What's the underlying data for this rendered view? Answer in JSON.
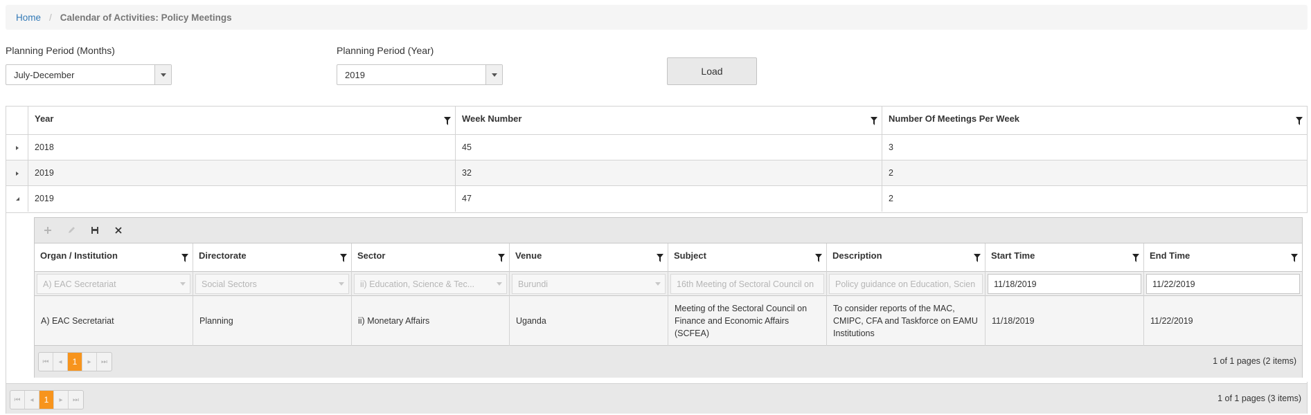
{
  "breadcrumb": {
    "home": "Home",
    "separator": "/",
    "current": "Calendar of Activities: Policy Meetings"
  },
  "filters": {
    "months_label": "Planning Period (Months)",
    "months_value": "July-December",
    "year_label": "Planning Period (Year)",
    "year_value": "2019",
    "load_label": "Load"
  },
  "grid": {
    "columns": [
      "Year",
      "Week Number",
      "Number Of Meetings Per Week"
    ],
    "rows": [
      {
        "year": "2018",
        "week": "45",
        "meetings": "3",
        "expanded": false
      },
      {
        "year": "2019",
        "week": "32",
        "meetings": "2",
        "expanded": false
      },
      {
        "year": "2019",
        "week": "47",
        "meetings": "2",
        "expanded": true
      }
    ],
    "pager": {
      "page": "1",
      "info": "1 of 1 pages (3 items)"
    }
  },
  "detail": {
    "columns": [
      "Organ / Institution",
      "Directorate",
      "Sector",
      "Venue",
      "Subject",
      "Description",
      "Start Time",
      "End Time"
    ],
    "edit_row": {
      "organ": "A) EAC Secretariat",
      "directorate": "Social Sectors",
      "sector": "ii) Education, Science & Tec...",
      "venue": "Burundi",
      "subject": "16th Meeting of Sectoral Council on",
      "description": "Policy guidance on Education, Scien",
      "start": "11/18/2019",
      "end": "11/22/2019"
    },
    "row": {
      "organ": "A) EAC Secretariat",
      "directorate": "Planning",
      "sector": "ii) Monetary Affairs",
      "venue": "Uganda",
      "subject": "Meeting of the Sectoral Council on Finance and Economic Affairs (SCFEA)",
      "description": "To consider reports of the MAC, CMIPC, CFA and Taskforce on EAMU Institutions",
      "start": "11/18/2019",
      "end": "11/22/2019"
    },
    "pager": {
      "page": "1",
      "info": "1 of 1 pages (2 items)"
    }
  },
  "colors": {
    "accent": "#f7941d",
    "link": "#337ab7"
  }
}
